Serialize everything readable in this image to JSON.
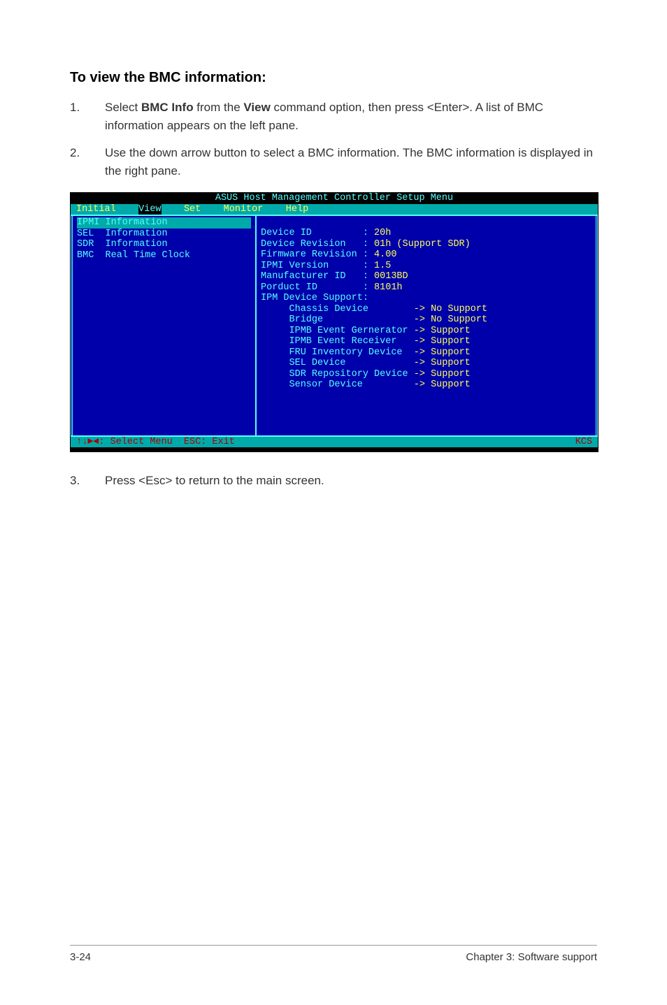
{
  "heading": "To view the BMC information:",
  "steps": [
    {
      "num": "1.",
      "text_prefix": "Select ",
      "bold1": "BMC Info",
      "text_mid": " from the ",
      "bold2": "View",
      "text_suffix": " command option, then press <Enter>. A list of BMC information appears on the left pane."
    },
    {
      "num": "2.",
      "text": "Use the down arrow button to select a BMC information. The BMC information is displayed in the right pane."
    }
  ],
  "terminal": {
    "title": "ASUS Host Management Controller Setup Menu",
    "menubar": {
      "items": [
        "Initial",
        "View",
        "Set",
        "Monitor",
        "Help"
      ],
      "selected_index": 1
    },
    "left_menu": [
      {
        "label": "IPMI Information",
        "selected": true
      },
      {
        "label": "SEL  Information",
        "selected": false
      },
      {
        "label": "SDR  Information",
        "selected": false
      },
      {
        "label": "BMC  Real Time Clock",
        "selected": false
      }
    ],
    "info_rows": [
      {
        "label": "Device ID         : ",
        "value": "20h"
      },
      {
        "label": "Device Revision   : ",
        "value": "01h (Support SDR)"
      },
      {
        "label": "Firmware Revision : ",
        "value": "4.00"
      },
      {
        "label": "IPMI Version      : ",
        "value": "1.5"
      },
      {
        "label": "Manufacturer ID   : ",
        "value": "0013BD"
      },
      {
        "label": "Porduct ID        : ",
        "value": "8101h"
      }
    ],
    "support_header": "IPM Device Support:",
    "support_rows": [
      {
        "label": "     Chassis Device        ",
        "arrow": "-> ",
        "value": "No Support"
      },
      {
        "label": "     Bridge                ",
        "arrow": "-> ",
        "value": "No Support"
      },
      {
        "label": "     IPMB Event Gernerator ",
        "arrow": "-> ",
        "value": "Support"
      },
      {
        "label": "     IPMB Event Receiver   ",
        "arrow": "-> ",
        "value": "Support"
      },
      {
        "label": "     FRU Inventory Device  ",
        "arrow": "-> ",
        "value": "Support"
      },
      {
        "label": "     SEL Device            ",
        "arrow": "-> ",
        "value": "Support"
      },
      {
        "label": "     SDR Repository Device ",
        "arrow": "-> ",
        "value": "Support"
      },
      {
        "label": "     Sensor Device         ",
        "arrow": "-> ",
        "value": "Support"
      }
    ],
    "status_left": "↑↓►◄: Select Menu  ESC: Exit",
    "status_right": "KCS"
  },
  "step3": {
    "num": "3.",
    "text": "Press <Esc> to return to the main screen."
  },
  "footer_left": "3-24",
  "footer_right": "Chapter 3: Software support"
}
